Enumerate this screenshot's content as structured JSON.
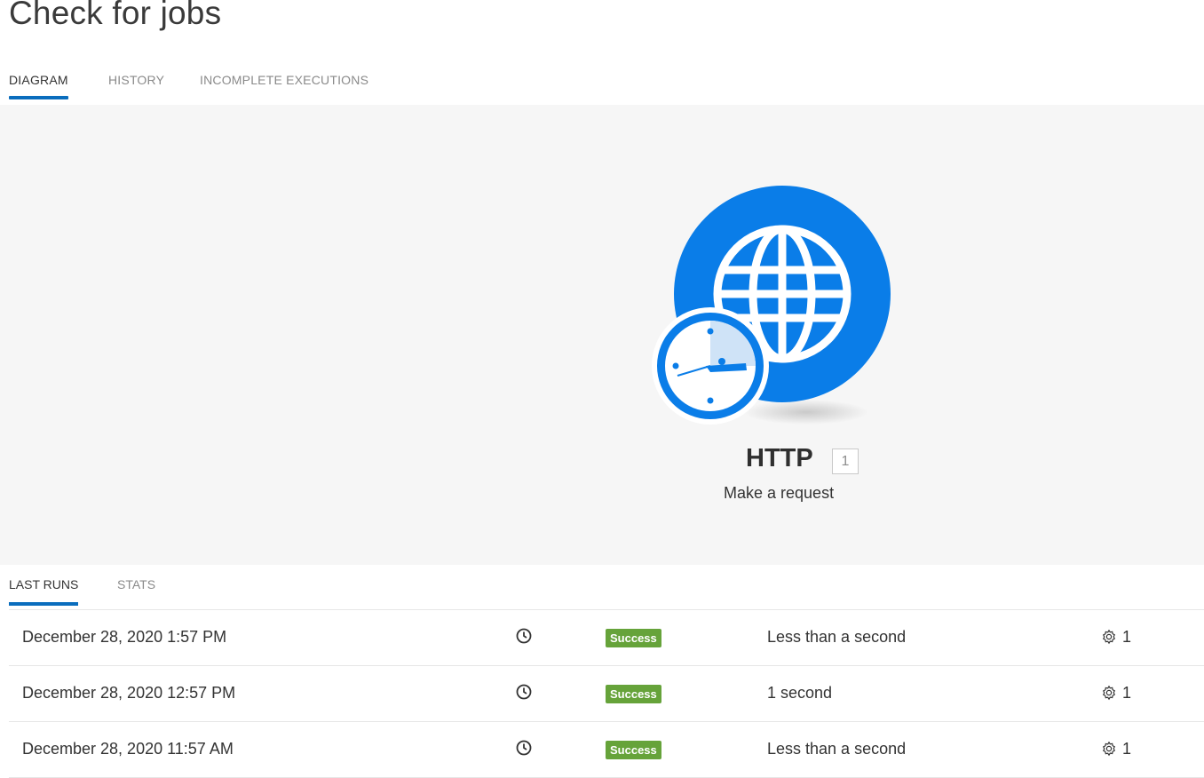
{
  "page": {
    "title": "Check for jobs"
  },
  "tabs": [
    {
      "label": "DIAGRAM",
      "active": true
    },
    {
      "label": "HISTORY",
      "active": false
    },
    {
      "label": "INCOMPLETE EXECUTIONS",
      "active": false
    }
  ],
  "module": {
    "name": "HTTP",
    "badge": "1",
    "description": "Make a request",
    "icon": "globe-icon",
    "trigger_icon": "clock-icon",
    "color": "#0a7de8"
  },
  "sub_tabs": [
    {
      "label": "LAST RUNS",
      "active": true
    },
    {
      "label": "STATS",
      "active": false
    }
  ],
  "runs": [
    {
      "date": "December 28, 2020 1:57 PM",
      "status": "Success",
      "duration": "Less than a second",
      "operations": "1"
    },
    {
      "date": "December 28, 2020 12:57 PM",
      "status": "Success",
      "duration": "1 second",
      "operations": "1"
    },
    {
      "date": "December 28, 2020 11:57 AM",
      "status": "Success",
      "duration": "Less than a second",
      "operations": "1"
    }
  ],
  "colors": {
    "accent": "#0a6dbd",
    "success": "#66a33a",
    "canvas_bg": "#f6f6f6"
  }
}
